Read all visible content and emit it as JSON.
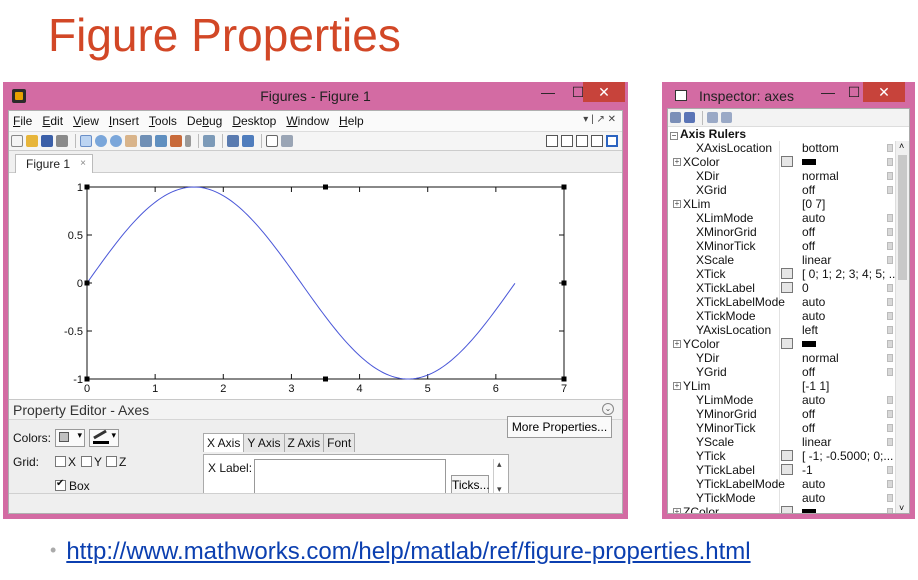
{
  "slide": {
    "title": "Figure Properties",
    "link": "http://www.mathworks.com/help/matlab/ref/figure-properties.html"
  },
  "figure_window": {
    "title": "Figures - Figure 1",
    "controls": {
      "minimize": "—",
      "maximize": "☐",
      "close": "✕"
    },
    "menu": [
      {
        "ul": "F",
        "rest": "ile"
      },
      {
        "ul": "E",
        "rest": "dit"
      },
      {
        "ul": "V",
        "rest": "iew"
      },
      {
        "ul": "I",
        "rest": "nsert"
      },
      {
        "ul": "T",
        "rest": "ools"
      },
      {
        "pre": "De",
        "ul": "b",
        "rest": "ug"
      },
      {
        "ul": "D",
        "rest": "esktop"
      },
      {
        "ul": "W",
        "rest": "indow"
      },
      {
        "ul": "H",
        "rest": "elp"
      }
    ],
    "menu_right": "▾ | ↗ ✕",
    "tab": {
      "label": "Figure 1",
      "close": "×"
    }
  },
  "chart_data": {
    "type": "line",
    "series": [
      {
        "function": "sin(x)",
        "x_start": 0,
        "x_end": 6.28,
        "color": "#4a57d8"
      }
    ],
    "xlim": [
      0,
      7
    ],
    "ylim": [
      -1,
      1
    ],
    "xticks": [
      0,
      1,
      2,
      3,
      4,
      5,
      6,
      7
    ],
    "yticks": [
      -1,
      -0.5,
      0,
      0.5,
      1
    ],
    "xtick_labels": [
      "0",
      "1",
      "2",
      "3",
      "4",
      "5",
      "6",
      "7"
    ],
    "ytick_labels": [
      "-1",
      "-0.5",
      "0",
      "0.5",
      "1"
    ],
    "box": true,
    "grid": false
  },
  "property_editor": {
    "title": "Property Editor - Axes",
    "colors_label": "Colors:",
    "grid_label": "Grid:",
    "grid_x": "X",
    "grid_y": "Y",
    "grid_z": "Z",
    "box_label": "Box",
    "tabs": [
      "X Axis",
      "Y Axis",
      "Z Axis",
      "Font"
    ],
    "xlabel_label": "X Label:",
    "ticks_button": "Ticks...",
    "more_button": "More Properties..."
  },
  "inspector": {
    "title": "Inspector:  axes",
    "group": "Axis Rulers",
    "rows": [
      {
        "name": "XAxisLocation",
        "value": "bottom",
        "dd": true
      },
      {
        "name": "XColor",
        "expand": true,
        "icon": true,
        "color": true,
        "dd": true
      },
      {
        "name": "XDir",
        "value": "normal",
        "dd": true
      },
      {
        "name": "XGrid",
        "value": "off",
        "dd": true
      },
      {
        "name": "XLim",
        "expand": true,
        "value": "[0 7]"
      },
      {
        "name": "XLimMode",
        "value": "auto",
        "dd": true
      },
      {
        "name": "XMinorGrid",
        "value": "off",
        "dd": true
      },
      {
        "name": "XMinorTick",
        "value": "off",
        "dd": true
      },
      {
        "name": "XScale",
        "value": "linear",
        "dd": true
      },
      {
        "name": "XTick",
        "icon": true,
        "value": "[ 0; 1; 2; 3; 4; 5; ..."
      },
      {
        "name": "XTickLabel",
        "icon": true,
        "value": "0",
        "dd": true
      },
      {
        "name": "XTickLabelMode",
        "value": "auto",
        "dd": true
      },
      {
        "name": "XTickMode",
        "value": "auto",
        "dd": true
      },
      {
        "name": "YAxisLocation",
        "value": "left",
        "dd": true
      },
      {
        "name": "YColor",
        "expand": true,
        "icon": true,
        "color": true,
        "dd": true
      },
      {
        "name": "YDir",
        "value": "normal",
        "dd": true
      },
      {
        "name": "YGrid",
        "value": "off",
        "dd": true
      },
      {
        "name": "YLim",
        "expand": true,
        "value": "[-1 1]"
      },
      {
        "name": "YLimMode",
        "value": "auto",
        "dd": true
      },
      {
        "name": "YMinorGrid",
        "value": "off",
        "dd": true
      },
      {
        "name": "YMinorTick",
        "value": "off",
        "dd": true
      },
      {
        "name": "YScale",
        "value": "linear",
        "dd": true
      },
      {
        "name": "YTick",
        "icon": true,
        "value": "[ -1; -0.5000; 0;..."
      },
      {
        "name": "YTickLabel",
        "icon": true,
        "value": "-1",
        "dd": true
      },
      {
        "name": "YTickLabelMode",
        "value": "auto",
        "dd": true
      },
      {
        "name": "YTickMode",
        "value": "auto",
        "dd": true
      },
      {
        "name": "ZColor",
        "expand": true,
        "icon": true,
        "color": true,
        "dd": true
      }
    ]
  },
  "colors": {
    "accent": "#d24726",
    "window_frame": "#d36ba3",
    "close_button": "#c7433b",
    "link": "#0b3fb0"
  }
}
